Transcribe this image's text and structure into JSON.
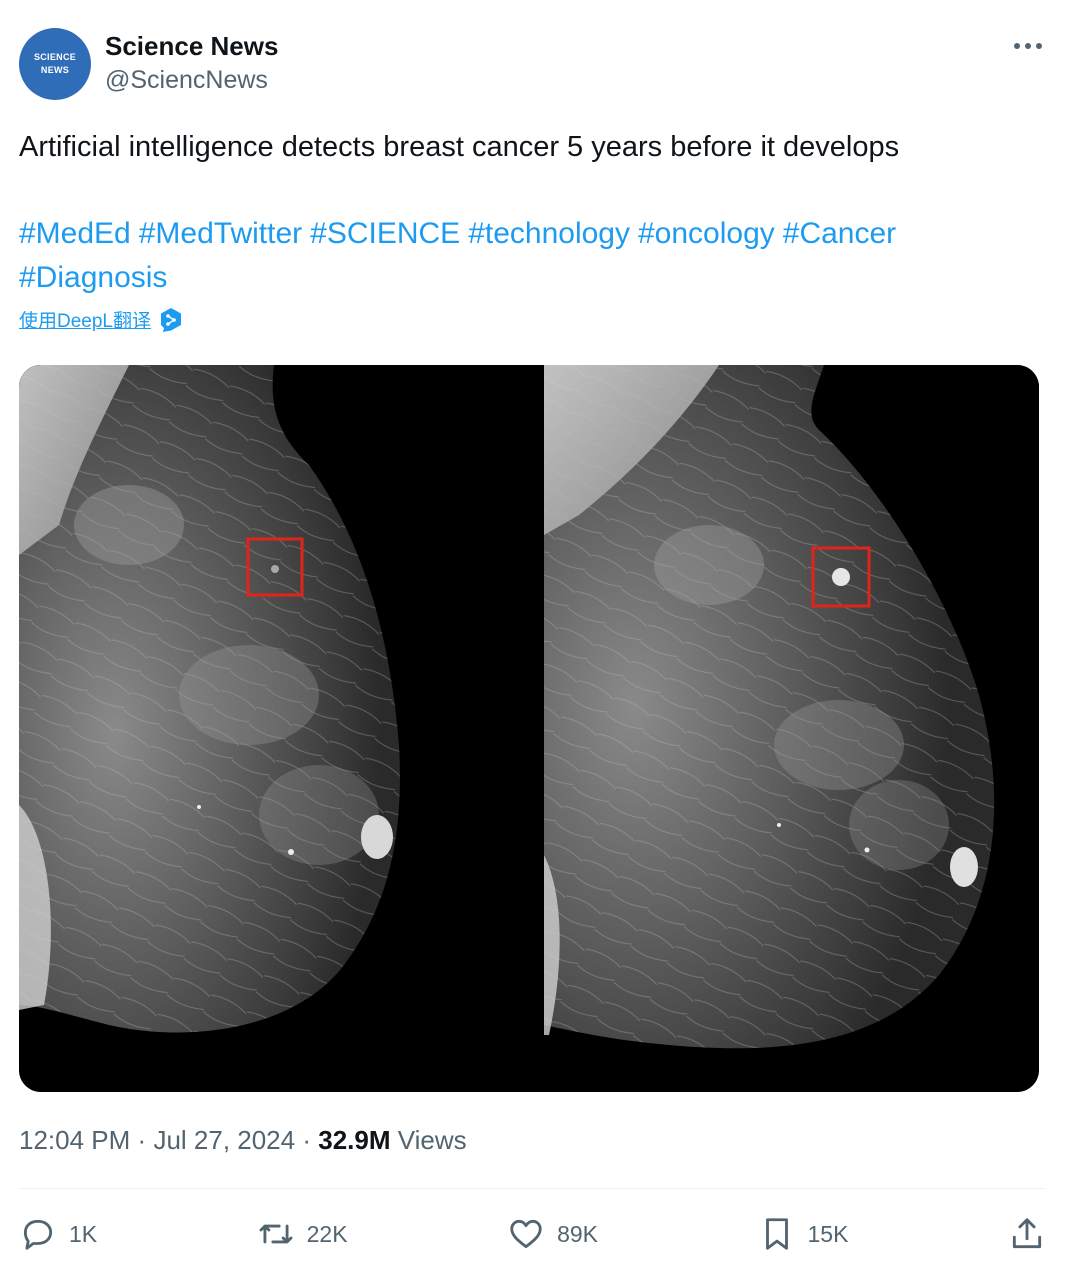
{
  "author": {
    "display_name": "Science News",
    "handle": "@SciencNews",
    "avatar_text_line1": "SCIENCE",
    "avatar_text_line2": "NEWS"
  },
  "tweet": {
    "text": "Artificial intelligence detects breast cancer 5 years before it develops",
    "hashtags": [
      "#MedEd",
      "#MedTwitter",
      "#SCIENCE",
      "#technology",
      "#oncology",
      "#Cancer",
      "#Diagnosis"
    ],
    "translate_label": "使用DeepL翻译"
  },
  "meta": {
    "time": "12:04 PM",
    "separator": "·",
    "date": "Jul 27, 2024",
    "views_count": "32.9M",
    "views_label": "Views"
  },
  "actions": {
    "replies": "1K",
    "reposts": "22K",
    "likes": "89K",
    "bookmarks": "15K"
  },
  "colors": {
    "link": "#1d9bf0",
    "secondary_text": "#536471",
    "avatar_bg": "#2f6db8",
    "highlight_box": "#e0241b"
  }
}
